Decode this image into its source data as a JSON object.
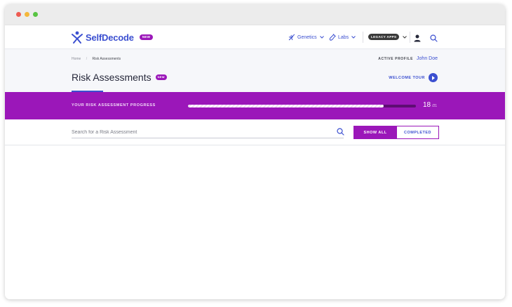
{
  "brand": {
    "name": "SelfDecode",
    "badge": "NEW",
    "color": "#3b4fd0",
    "accent": "#9b17b9"
  },
  "nav": {
    "items": [
      {
        "label": "Genetics",
        "icon": "dna-icon"
      },
      {
        "label": "Labs",
        "icon": "lab-tube-icon"
      }
    ],
    "legacy_apps": "LEGACY APPS",
    "user_icon": "user-icon",
    "search_icon": "search-icon"
  },
  "breadcrumb": {
    "home": "Home",
    "current": "Risk Assessments"
  },
  "active_profile": {
    "label": "ACTIVE PROFILE",
    "name": "John Doe"
  },
  "page": {
    "title": "Risk Assessments",
    "badge": "NEW"
  },
  "welcome_tour": {
    "label": "WELCOME TOUR",
    "icon": "play-icon"
  },
  "progress": {
    "label": "YOUR RISK ASSESSMENT PROGRESS",
    "done": "18",
    "total": "21",
    "fraction": 0.857
  },
  "search": {
    "placeholder": "Search for a Risk Assessment",
    "value": ""
  },
  "filters": {
    "show_all": "SHOW ALL",
    "completed": "COMPLETED",
    "selected": "SHOW ALL"
  }
}
